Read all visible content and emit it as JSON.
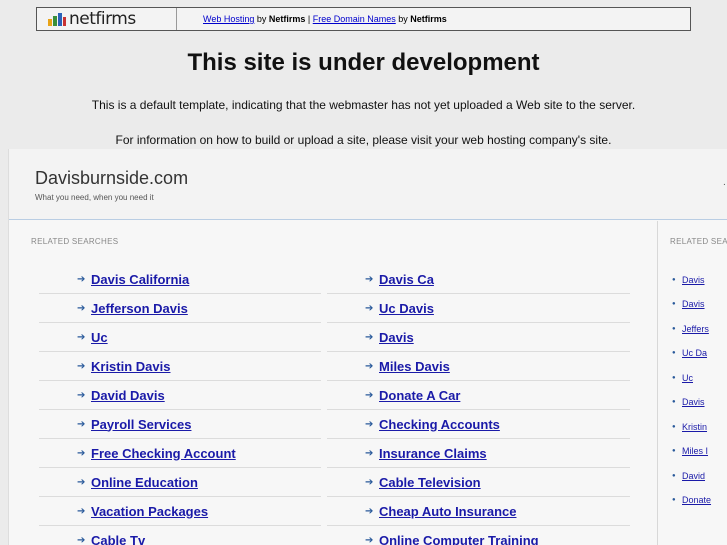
{
  "banner": {
    "logo_text": "netfirms",
    "link1": "Web Hosting",
    "by1": " by ",
    "brand1": "Netfirms",
    "sep": " | ",
    "link2": "Free Domain Names",
    "by2": " by ",
    "brand2": "Netfirms"
  },
  "headline": "This site is under development",
  "message1": "This is a default template, indicating that the webmaster has not yet uploaded a Web site to the server.",
  "message2": "For information on how to build or upload a site, please visit your web hosting company's site.",
  "site": {
    "title": "Davisburnside.com",
    "tagline": "What you need, when you need it",
    "right_mark": "."
  },
  "main": {
    "label": "RELATED SEARCHES",
    "left_links": [
      "Davis California",
      "Jefferson Davis",
      "Uc",
      "Kristin Davis",
      "David Davis",
      "Payroll Services",
      "Free Checking Account",
      "Online Education",
      "Vacation Packages",
      "Cable Tv"
    ],
    "right_links": [
      "Davis Ca",
      "Uc Davis",
      "Davis",
      "Miles Davis",
      "Donate A Car",
      "Checking Accounts",
      "Insurance Claims",
      "Cable Television",
      "Cheap Auto Insurance",
      "Online Computer Training"
    ]
  },
  "side": {
    "label": "RELATED SEA",
    "links": [
      "Davis",
      "Davis",
      "Jeffers",
      "Uc Da",
      "Uc",
      "Davis",
      "Kristin",
      "Miles I",
      "David",
      "Donate"
    ]
  },
  "colors": {
    "link": "#1a1aa8",
    "background": "#ebebeb",
    "frame": "#f7f7f7"
  }
}
